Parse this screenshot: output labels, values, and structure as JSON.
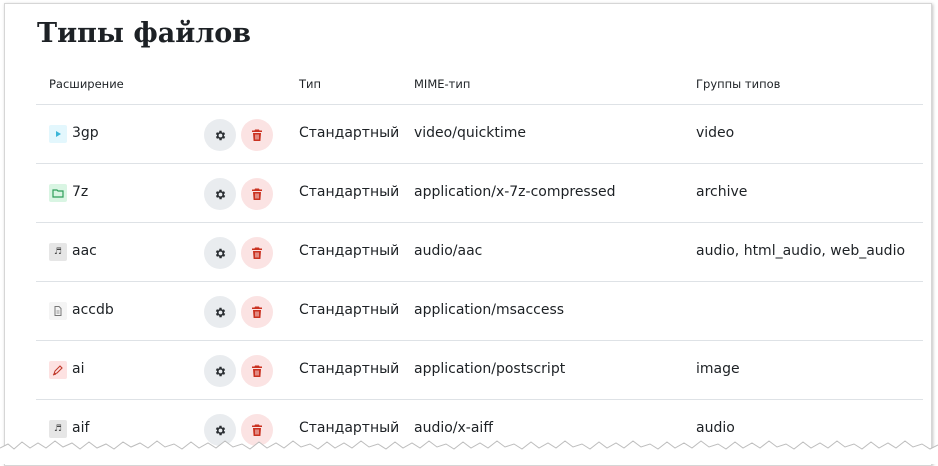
{
  "page": {
    "title": "Типы файлов"
  },
  "table": {
    "headers": {
      "extension": "Расширение",
      "type": "Тип",
      "mime": "MIME-тип",
      "groups": "Группы типов"
    },
    "rows": [
      {
        "ext": "3gp",
        "icon": "video-file-icon",
        "icon_color": "#e3f7fd",
        "icon_glyph_color": "#3bb6d8",
        "type": "Стандартный",
        "mime": "video/quicktime",
        "groups": "video"
      },
      {
        "ext": "7z",
        "icon": "archive-folder-icon",
        "icon_color": "#d9f5e3",
        "icon_glyph_color": "#2f9e5a",
        "type": "Стандартный",
        "mime": "application/x-7z-compressed",
        "groups": "archive"
      },
      {
        "ext": "aac",
        "icon": "audio-note-icon",
        "icon_color": "#e6e6e6",
        "icon_glyph_color": "#444444",
        "type": "Стандартный",
        "mime": "audio/aac",
        "groups": "audio, html_audio, web_audio"
      },
      {
        "ext": "accdb",
        "icon": "document-icon",
        "icon_color": "#f4f4f4",
        "icon_glyph_color": "#777777",
        "type": "Стандартный",
        "mime": "application/msaccess",
        "groups": ""
      },
      {
        "ext": "ai",
        "icon": "vector-pen-icon",
        "icon_color": "#fde2e2",
        "icon_glyph_color": "#c0392b",
        "type": "Стандартный",
        "mime": "application/postscript",
        "groups": "image"
      },
      {
        "ext": "aif",
        "icon": "audio-note-icon",
        "icon_color": "#e6e6e6",
        "icon_glyph_color": "#444444",
        "type": "Стандартный",
        "mime": "audio/x-aiff",
        "groups": "audio"
      }
    ]
  },
  "actions": {
    "settings_icon": "gear-icon",
    "delete_icon": "trash-icon",
    "settings_bg": "#e9ecef",
    "delete_bg": "#fbe3e3",
    "delete_color": "#ca3120"
  }
}
